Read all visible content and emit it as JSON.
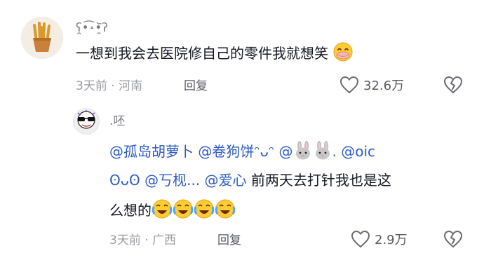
{
  "comment": {
    "username": "ʕ̯•͡˔•̯᷅ʔ",
    "text": "一想到我会去医院修自己的零件我就想笑",
    "time": "3天前",
    "location": "河南",
    "reply_label": "回复",
    "like_count": "32.6万",
    "emoji_name": "smiling-face-with-hand-over-mouth"
  },
  "reply": {
    "username": ".呸",
    "line1": {
      "mention1": "@孤岛胡萝卜",
      "mention2": "@卷狗饼ᵔᴗᵔ",
      "mention3_prefix": "@",
      "mention3_suffix": ". @oic"
    },
    "line2": {
      "kaomoji": "ʘᴗʘ",
      "mention4": "@丂枧...",
      "mention5": "@爱心",
      "text": "前两天去打针我也是这"
    },
    "line3": {
      "text": "么想的"
    },
    "time": "3天前",
    "location": "广西",
    "reply_label": "回复",
    "like_count": "2.9万",
    "emoji_names": [
      "rabbit-face",
      "rabbit-face",
      "loudly-crying-laughing-face",
      "loudly-crying-laughing-face",
      "loudly-crying-laughing-face",
      "loudly-crying-laughing-face"
    ]
  },
  "colors": {
    "mention": "#2d5bc2",
    "meta": "#9b9ca3",
    "text": "#161823"
  }
}
